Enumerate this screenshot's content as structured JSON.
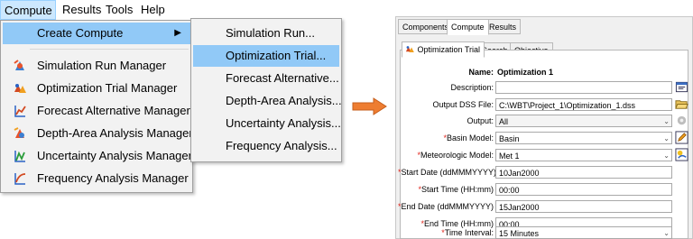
{
  "menubar": {
    "items": [
      "Compute",
      "Results",
      "Tools",
      "Help"
    ]
  },
  "compute_menu": {
    "create_compute": "Create Compute",
    "managers": [
      {
        "label": "Simulation Run Manager",
        "icon": "simulation-run-icon"
      },
      {
        "label": "Optimization Trial Manager",
        "icon": "optimization-trial-icon"
      },
      {
        "label": "Forecast Alternative Manager",
        "icon": "forecast-alternative-icon"
      },
      {
        "label": "Depth-Area Analysis Manager",
        "icon": "depth-area-analysis-icon"
      },
      {
        "label": "Uncertainty Analysis Manager",
        "icon": "uncertainty-analysis-icon"
      },
      {
        "label": "Frequency Analysis Manager",
        "icon": "frequency-analysis-icon"
      }
    ]
  },
  "create_submenu": {
    "items": [
      "Simulation Run...",
      "Optimization Trial...",
      "Forecast Alternative...",
      "Depth-Area Analysis...",
      "Uncertainty Analysis...",
      "Frequency Analysis..."
    ],
    "highlighted_index": 1
  },
  "editor": {
    "top_tabs": [
      "Components",
      "Compute",
      "Results"
    ],
    "selected_top_tab": "Compute",
    "sub_tabs": [
      "Optimization Trial",
      "Search",
      "Objective"
    ],
    "selected_sub_tab": "Optimization Trial",
    "name_label": "Name:",
    "name_value": "Optimization 1",
    "fields": {
      "description": {
        "label": "Description:",
        "value": ""
      },
      "output_dss": {
        "label": "Output DSS File:",
        "value": "C:\\WBT\\Project_1\\Optimization_1.dss"
      },
      "output": {
        "label": "Output:",
        "value": "All"
      },
      "basin_model": {
        "label": "Basin Model:",
        "value": "Basin"
      },
      "met_model": {
        "label": "Meteorologic Model:",
        "value": "Met 1"
      },
      "start_date": {
        "label": "Start Date (ddMMMYYYY)",
        "value": "10Jan2000"
      },
      "start_time": {
        "label": "Start Time (HH:mm)",
        "value": "00:00"
      },
      "end_date": {
        "label": "End Date (ddMMMYYYY)",
        "value": "15Jan2000"
      },
      "end_time": {
        "label": "End Time (HH:mm)",
        "value": "00:00"
      },
      "time_interval": {
        "label": "Time Interval:",
        "value": "15 Minutes"
      }
    }
  },
  "colors": {
    "menu_highlight": "#91c9f7",
    "menubar_active": "#cce8ff",
    "required_asterisk": "#e0241b",
    "arrow": "#ee7d31"
  }
}
